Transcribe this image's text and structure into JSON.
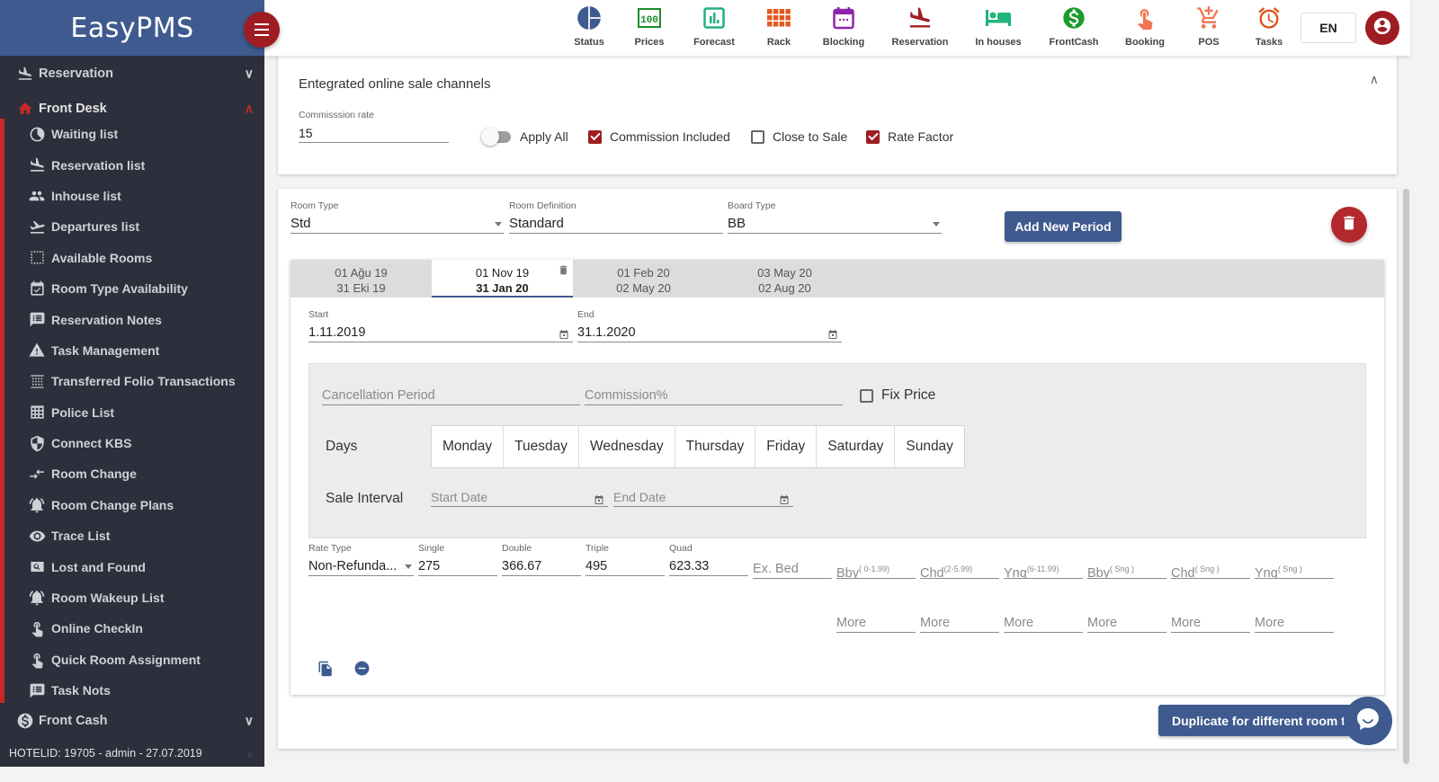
{
  "brand": {
    "title": "EasyPMS"
  },
  "sidebar": {
    "groups": {
      "reservation": {
        "label": "Reservation",
        "icon": "flight-land-icon"
      },
      "front_desk": {
        "label": "Front Desk",
        "icon": "home-icon"
      },
      "front_cash": {
        "label": "Front Cash",
        "icon": "dollar-circle-icon"
      }
    },
    "items": [
      {
        "label": "Waiting list",
        "icon": "clock-icon"
      },
      {
        "label": "Reservation list",
        "icon": "flight-land-icon"
      },
      {
        "label": "Inhouse list",
        "icon": "people-icon"
      },
      {
        "label": "Departures list",
        "icon": "flight-takeoff-icon"
      },
      {
        "label": "Available Rooms",
        "icon": "select-all-icon"
      },
      {
        "label": "Room Type Availability",
        "icon": "event-available-icon"
      },
      {
        "label": "Reservation Notes",
        "icon": "notes-icon"
      },
      {
        "label": "Task Management",
        "icon": "warning-icon"
      },
      {
        "label": "Transferred Folio Transactions",
        "icon": "grid-lines-icon"
      },
      {
        "label": "Police List",
        "icon": "table-icon"
      },
      {
        "label": "Connect KBS",
        "icon": "shield-icon"
      },
      {
        "label": "Room Change",
        "icon": "swap-arrows-icon"
      },
      {
        "label": "Room Change Plans",
        "icon": "alarm-bell-icon"
      },
      {
        "label": "Trace List",
        "icon": "eye-icon"
      },
      {
        "label": "Lost and Found",
        "icon": "search-box-icon"
      },
      {
        "label": "Room Wakeup List",
        "icon": "alarm-bell-icon"
      },
      {
        "label": "Online CheckIn",
        "icon": "touch-icon"
      },
      {
        "label": "Quick Room Assignment",
        "icon": "touch-icon"
      },
      {
        "label": "Task Nots",
        "icon": "notes-icon"
      }
    ],
    "footer": "HOTELID: 19705 - admin - 27.07.2019"
  },
  "topbar": {
    "items": [
      {
        "label": "Status",
        "color": "#3f5a8f"
      },
      {
        "label": "Prices",
        "color": "#1e8c2c"
      },
      {
        "label": "Forecast",
        "color": "#23b07d"
      },
      {
        "label": "Rack",
        "color": "#e05a1e"
      },
      {
        "label": "Blocking",
        "color": "#8e24aa"
      },
      {
        "label": "Reservation",
        "color": "#a11d22"
      },
      {
        "label": "In houses",
        "color": "#1fb57a"
      },
      {
        "label": "FrontCash",
        "color": "#1a9b2c"
      },
      {
        "label": "Booking",
        "color": "#f07552"
      },
      {
        "label": "POS",
        "color": "#f07552"
      },
      {
        "label": "Tasks",
        "color": "#e0531e"
      }
    ],
    "lang": "EN"
  },
  "channels": {
    "title": "Entegrated online sale channels",
    "commission_label": "Commisssion rate",
    "commission_value": "15",
    "apply_all": "Apply All",
    "commission_included": "Commission Included",
    "close_to_sale": "Close to Sale",
    "rate_factor": "Rate Factor",
    "checked": {
      "commission_included": true,
      "close_to_sale": false,
      "rate_factor": true,
      "apply_all": false
    }
  },
  "room": {
    "room_type_label": "Room Type",
    "room_type": "Std",
    "room_def_label": "Room Definition",
    "room_def": "Standard",
    "board_label": "Board Type",
    "board": "BB",
    "add_period": "Add New Period"
  },
  "periods": [
    {
      "start": "01 Ağu 19",
      "end": "31 Eki 19",
      "active": false
    },
    {
      "start": "01 Nov 19",
      "end": "31 Jan 20",
      "active": true
    },
    {
      "start": "01 Feb 20",
      "end": "02 May 20",
      "active": false
    },
    {
      "start": "03 May 20",
      "end": "02 Aug 20",
      "active": false
    }
  ],
  "period": {
    "start_label": "Start",
    "start": "1.11.2019",
    "end_label": "End",
    "end": "31.1.2020",
    "cancellation_ph": "Cancellation Period",
    "commission_ph": "Commission%",
    "fix_price": "Fix Price",
    "days_label": "Days",
    "days": [
      "Monday",
      "Tuesday",
      "Wednesday",
      "Thursday",
      "Friday",
      "Saturday",
      "Sunday"
    ],
    "sale_interval_label": "Sale Interval",
    "sale_start_ph": "Start Date",
    "sale_end_ph": "End Date"
  },
  "rates": {
    "rate_type_label": "Rate Type",
    "rate_type": "Non-Refunda...",
    "single_label": "Single",
    "single": "275",
    "double_label": "Double",
    "double": "366.67",
    "triple_label": "Triple",
    "triple": "495",
    "quad_label": "Quad",
    "quad": "623.33",
    "extra_bed_ph": "Ex. Bed",
    "children": [
      {
        "base": "Bby",
        "sup": "( 0-1.99)"
      },
      {
        "base": "Chd",
        "sup": "(2-5.99)"
      },
      {
        "base": "Yng",
        "sup": "(6-11.99)"
      },
      {
        "base": "Bby",
        "sup": "( Sng )"
      },
      {
        "base": "Chd",
        "sup": "( Sng )"
      },
      {
        "base": "Yng",
        "sup": "( Sng )"
      }
    ],
    "more": "More"
  },
  "duplicate_btn": "Duplicate for different room types"
}
